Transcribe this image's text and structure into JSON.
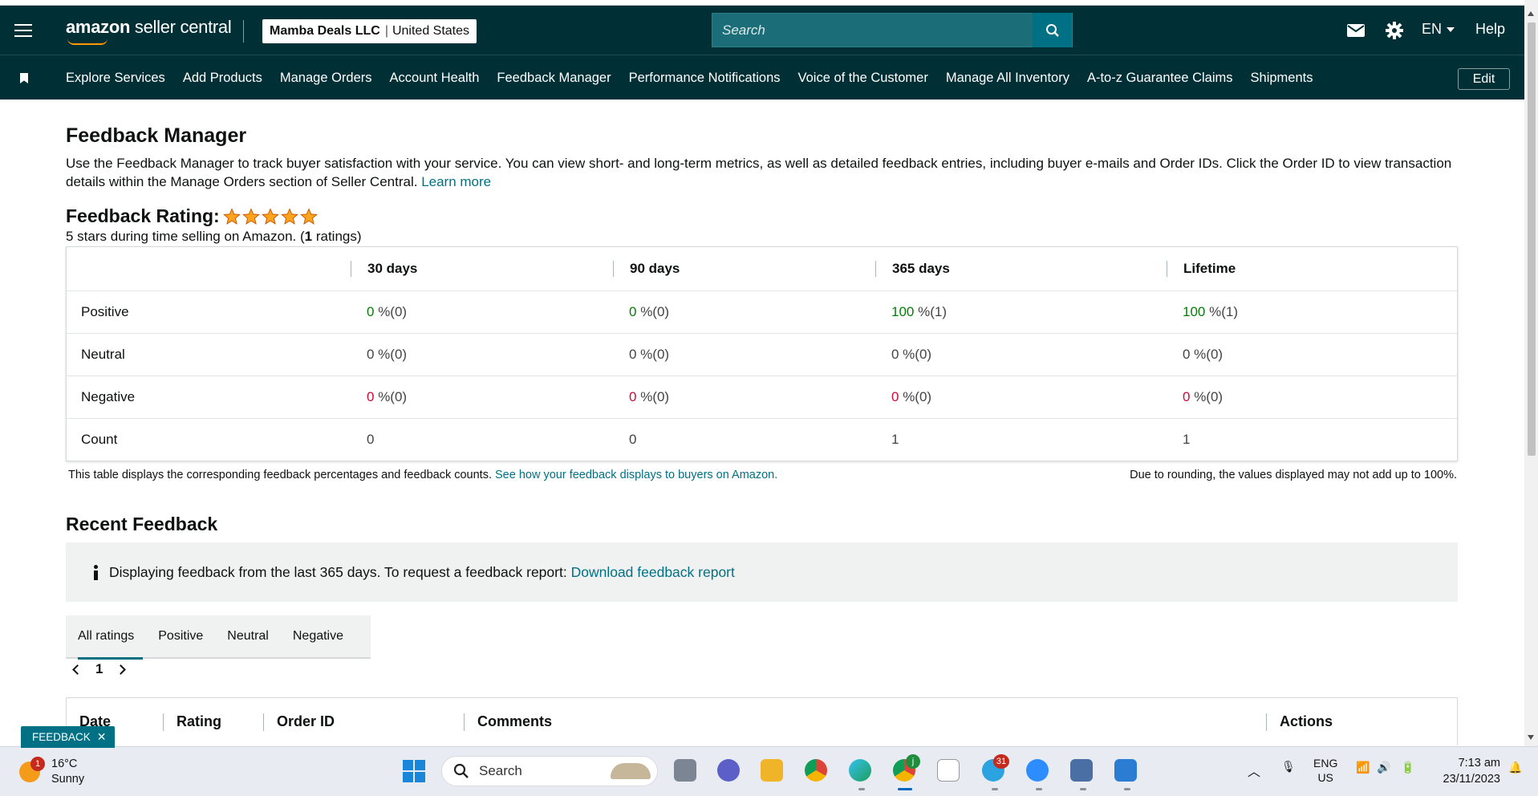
{
  "header": {
    "logo_text_bold": "amazon",
    "logo_text_rest": " seller central",
    "account_name": "Mamba Deals LLC",
    "account_region": "United States",
    "search_placeholder": "Search",
    "language": "EN",
    "help": "Help",
    "icons": [
      "menu-icon",
      "mail-icon",
      "settings-icon",
      "search-icon"
    ]
  },
  "nav": {
    "items": [
      "Explore Services",
      "Add Products",
      "Manage Orders",
      "Account Health",
      "Feedback Manager",
      "Performance Notifications",
      "Voice of the Customer",
      "Manage All Inventory",
      "A-to-z Guarantee Claims",
      "Shipments"
    ],
    "edit": "Edit"
  },
  "page": {
    "title": "Feedback Manager",
    "intro": "Use the Feedback Manager to track buyer satisfaction with your service. You can view short- and long-term metrics, as well as detailed feedback entries, including buyer e-mails and Order IDs. Click the Order ID to view transaction details within the Manage Orders section of Seller Central.",
    "learn_more": "Learn more",
    "rating_label": "Feedback Rating:",
    "star_count": 5,
    "rating_sub_prefix": "5 stars during time selling on Amazon. (",
    "rating_sub_count": "1",
    "rating_sub_suffix": " ratings)"
  },
  "feedback_table": {
    "columns": [
      "30 days",
      "90 days",
      "365 days",
      "Lifetime"
    ],
    "rows": {
      "positive": {
        "label": "Positive",
        "values": [
          [
            "0",
            " %(0)"
          ],
          [
            "0",
            " %(0)"
          ],
          [
            "100",
            " %(1)"
          ],
          [
            "100",
            " %(1)"
          ]
        ]
      },
      "neutral": {
        "label": "Neutral",
        "values": [
          "0 %(0)",
          "0 %(0)",
          "0 %(0)",
          "0 %(0)"
        ]
      },
      "negative": {
        "label": "Negative",
        "values": [
          [
            "0",
            " %(0)"
          ],
          [
            "0",
            " %(0)"
          ],
          [
            "0",
            " %(0)"
          ],
          [
            "0",
            " %(0)"
          ]
        ]
      },
      "count": {
        "label": "Count",
        "values": [
          "0",
          "0",
          "1",
          "1"
        ]
      }
    },
    "note": "This table displays the corresponding feedback percentages and feedback counts.",
    "note_link": "See how your feedback displays to buyers on Amazon.",
    "note_right": "Due to rounding, the values displayed may not add up to 100%."
  },
  "recent": {
    "title": "Recent Feedback",
    "info": "Displaying feedback from the last 365 days. To request a feedback report:",
    "info_link": "Download feedback report",
    "tabs": [
      "All ratings",
      "Positive",
      "Neutral",
      "Negative"
    ],
    "page": "1",
    "list_columns": [
      "Date",
      "Rating",
      "Order ID",
      "Comments",
      "Actions"
    ]
  },
  "feedback_button": "FEEDBACK",
  "taskbar": {
    "weather_badge": "1",
    "temperature": "16°C",
    "condition": "Sunny",
    "search": "Search",
    "telegram_badge": "31",
    "chrome_badge": "j",
    "lang_top": "ENG",
    "lang_bottom": "US",
    "time": "7:13 am",
    "date": "23/11/2023"
  }
}
